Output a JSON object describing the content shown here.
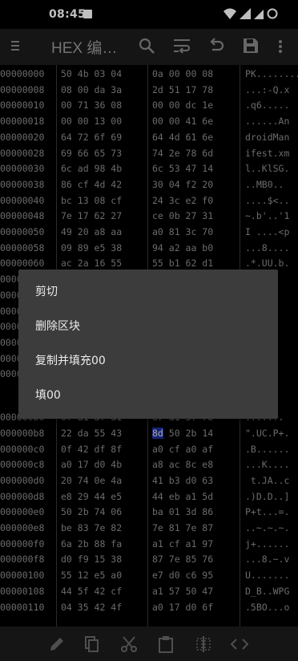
{
  "status_bar": {
    "time": "08:45"
  },
  "toolbar": {
    "title": "HEX 编…"
  },
  "hex_rows": [
    {
      "offset": "00000000",
      "g1": "50 4b 03 04",
      "g2": "0a 00 00 08",
      "ascii": "PK........"
    },
    {
      "offset": "00000008",
      "g1": "08 00 da 3a",
      "g2": "2d 51 17 78",
      "ascii": "...:-Q.x"
    },
    {
      "offset": "00000010",
      "g1": "00 71 36 08",
      "g2": "00 00 dc 1e",
      "ascii": ".q6....."
    },
    {
      "offset": "00000018",
      "g1": "00 00 13 00",
      "g2": "00 00 41 6e",
      "ascii": "......An"
    },
    {
      "offset": "00000020",
      "g1": "64 72 6f 69",
      "g2": "64 4d 61 6e",
      "ascii": "droidMan"
    },
    {
      "offset": "00000028",
      "g1": "69 66 65 73",
      "g2": "74 2e 78 6d",
      "ascii": "ifest.xm"
    },
    {
      "offset": "00000030",
      "g1": "6c ad 98 4b",
      "g2": "6c 53 47 14",
      "ascii": "l..KlSG."
    },
    {
      "offset": "00000038",
      "g1": "86 cf 4d 42",
      "g2": "30 04 f2 20",
      "ascii": "..MB0.."
    },
    {
      "offset": "00000040",
      "g1": "bc 13 08 cf",
      "g2": "24 3c e2 f0",
      "ascii": "....$<.."
    },
    {
      "offset": "00000048",
      "g1": "7e 17 62 27",
      "g2": "ce 0b 27 31",
      "ascii": "~.b'..'1"
    },
    {
      "offset": "00000050",
      "g1": "49 20 a8 aa",
      "g2": "a0 81 3c 70",
      "ascii": "I ....<p"
    },
    {
      "offset": "00000058",
      "g1": "09 89 e5 38",
      "g2": "94 a2 aa b0",
      "ascii": "...8...."
    },
    {
      "offset": "00000060",
      "g1": "ac 2a 16 55",
      "g2": "55 b1 62 d1",
      "ascii": ".*.UU.b."
    },
    {
      "offset": "00000068",
      "g1": "",
      "g2": "",
      "ascii": "E"
    },
    {
      "offset": "00000070",
      "g1": "",
      "g2": "",
      "ascii": ""
    },
    {
      "offset": "00000078",
      "g1": "",
      "g2": "",
      "ascii": ">w."
    },
    {
      "offset": "00000080",
      "g1": "",
      "g2": "",
      "ascii": ""
    },
    {
      "offset": "00000088",
      "g1": "",
      "g2": "",
      "ascii": ""
    },
    {
      "offset": "00000090",
      "g1": "",
      "g2": "",
      "ascii": ""
    },
    {
      "offset": "00000098",
      "g1": "",
      "g2": "",
      "ascii": "AW."
    },
    {
      "offset": "000000b0",
      "g1": "0f a1 af a1",
      "g2": "e7 a1 3f 78",
      "ascii": ".....?."
    },
    {
      "offset": "000000b8",
      "g1": "22 da 55 43",
      "g2": "8d 50 2b 14",
      "ascii": "\".UC.P+."
    },
    {
      "offset": "000000c0",
      "g1": "0f 42 df 8f",
      "g2": "a0 cf a0 af",
      "ascii": ".B......"
    },
    {
      "offset": "000000c8",
      "g1": "a0 17 d0 4b",
      "g2": "a8 ac 8c e8",
      "ascii": "...K...."
    },
    {
      "offset": "000000d0",
      "g1": "20 74 0e 4a",
      "g2": "41 b3 d0 63",
      "ascii": " t.JA..c"
    },
    {
      "offset": "000000d8",
      "g1": "e8 29 44 e5",
      "g2": "44 eb a1 5d",
      "ascii": ".)D.D..]"
    },
    {
      "offset": "000000e0",
      "g1": "50 2b 74 06",
      "g2": "ba 01 3d 86",
      "ascii": "P+t...=."
    },
    {
      "offset": "000000e8",
      "g1": "be 83 7e 82",
      "g2": "7e 81 7e 87",
      "ascii": "..~.~.~."
    },
    {
      "offset": "000000f0",
      "g1": "6a 2b 88 fa",
      "g2": "a1 cf a1 97",
      "ascii": "j+......"
    },
    {
      "offset": "000000f8",
      "g1": "d0 f9 15 38",
      "g2": "87 7e 85 76",
      "ascii": "...8.~.v"
    },
    {
      "offset": "00000100",
      "g1": "55 12 e5 a0",
      "g2": "e7 d0 c6 95",
      "ascii": "U......."
    },
    {
      "offset": "00000108",
      "g1": "44 5f 42 cf",
      "g2": "a1 57 50 47",
      "ascii": "D_B..WPG"
    },
    {
      "offset": "00000110",
      "g1": "04 35 42 4f",
      "g2": "a0 17 d0 6f",
      "ascii": ".5BO...o"
    }
  ],
  "context_menu": {
    "items": [
      "剪切",
      "删除区块",
      "复制并填充00",
      "填00"
    ]
  },
  "colors": {
    "background": "#000000",
    "toolbar": "#1c1c1c",
    "menu": "#3c3c3c",
    "selection": "#1e2fa0"
  }
}
